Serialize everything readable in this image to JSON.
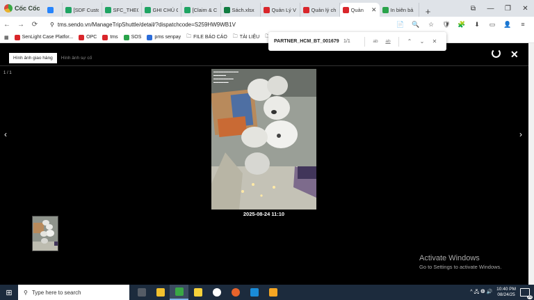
{
  "browser": {
    "brand": "Cốc Cốc",
    "tabs": [
      {
        "title": "",
        "color": "#2684fc",
        "narrow": true
      },
      {
        "title": "[SDF Custo",
        "color": "#1fa463"
      },
      {
        "title": "SFC_THEO",
        "color": "#1fa463"
      },
      {
        "title": "GHI CHÚ C",
        "color": "#1fa463"
      },
      {
        "title": "[Claim & C",
        "color": "#1fa463"
      },
      {
        "title": "Sách.xlsx",
        "color": "#107c41"
      },
      {
        "title": "Quản Lý V",
        "color": "#d9262b"
      },
      {
        "title": "Quản lý ch",
        "color": "#d9262b"
      },
      {
        "title": "Quản",
        "color": "#d9262b",
        "active": true
      },
      {
        "title": "In biên bả",
        "color": "#2aa34a"
      }
    ],
    "new_tab": "+",
    "window_controls": [
      "⧉",
      "—",
      "❐",
      "✕"
    ],
    "nav": {
      "back": "←",
      "forward": "→",
      "reload": "⟳"
    },
    "url": "tms.sendo.vn/ManageTripShuttle/detail/?dispatchcode=S259HW9WB1V",
    "toolbar_icons": [
      "📄",
      "🔍",
      "☆",
      "🛡",
      "🧩",
      "⬇",
      "▭",
      "👤",
      "≡"
    ],
    "bookmarks": [
      {
        "label": "SenLight Case Platfor...",
        "color": "#d9262b"
      },
      {
        "label": "OPC",
        "color": "#d9262b"
      },
      {
        "label": "tms",
        "color": "#d9262b"
      },
      {
        "label": "SOS",
        "color": "#2aa34a"
      },
      {
        "label": "pms senpay",
        "color": "#2b6cd9"
      },
      {
        "label": "FILE BÁO CÁO",
        "color": "folder"
      },
      {
        "label": "TÀI LIỆU",
        "color": "folder"
      },
      {
        "label": "FIL",
        "color": "folder"
      }
    ]
  },
  "find_bar": {
    "query": "PARTNER_HCM_BT_001679",
    "count": "1/1",
    "opt_case": "ab",
    "opt_word": "ab",
    "prev": "⌃",
    "next": "⌄",
    "close": "✕"
  },
  "viewer": {
    "tabs": [
      "Hình ảnh giao hàng",
      "Hình ảnh sự cố"
    ],
    "counter": "1 / 1",
    "prev_arrow": "‹",
    "next_arrow": "›",
    "close": "✕",
    "photo_caption": "2025-08-24 11:10"
  },
  "windows_watermark": {
    "title": "Activate Windows",
    "subtitle": "Go to Settings to activate Windows."
  },
  "taskbar": {
    "start": "⊞",
    "search_placeholder": "Type here to search",
    "apps": [
      {
        "color": "#555c66"
      },
      {
        "color": "#f2c12e"
      },
      {
        "color": "#3aa845",
        "active": true
      },
      {
        "color": "#f8d23a"
      },
      {
        "color": "#ffffff"
      },
      {
        "color": "#e8642b"
      },
      {
        "color": "#1a8cd8"
      },
      {
        "color": "#f5a623"
      }
    ],
    "tray_icons": "^ 🖧 ◍ 🔊",
    "time": "10:40 PM",
    "date": "08/24/25",
    "notifications": "20"
  }
}
